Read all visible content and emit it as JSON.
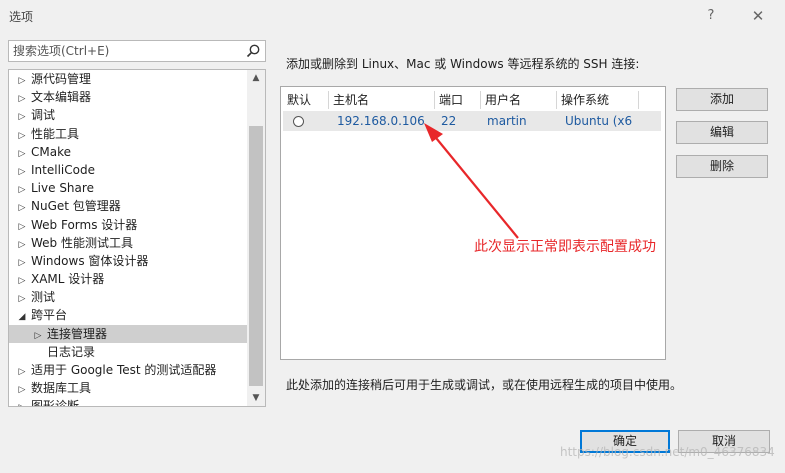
{
  "window": {
    "title": "选项",
    "help": "?",
    "close": "✕"
  },
  "search": {
    "placeholder": "搜索选项(Ctrl+E)"
  },
  "tree": [
    {
      "label": "源代码管理",
      "toggle": "▷"
    },
    {
      "label": "文本编辑器",
      "toggle": "▷"
    },
    {
      "label": "调试",
      "toggle": "▷"
    },
    {
      "label": "性能工具",
      "toggle": "▷"
    },
    {
      "label": "CMake",
      "toggle": "▷"
    },
    {
      "label": "IntelliCode",
      "toggle": "▷"
    },
    {
      "label": "Live Share",
      "toggle": "▷"
    },
    {
      "label": "NuGet 包管理器",
      "toggle": "▷"
    },
    {
      "label": "Web Forms 设计器",
      "toggle": "▷"
    },
    {
      "label": "Web 性能测试工具",
      "toggle": "▷"
    },
    {
      "label": "Windows 窗体设计器",
      "toggle": "▷"
    },
    {
      "label": "XAML 设计器",
      "toggle": "▷"
    },
    {
      "label": "测试",
      "toggle": "▷"
    },
    {
      "label": "跨平台",
      "toggle": "◢"
    },
    {
      "label": "连接管理器",
      "toggle": "▷"
    },
    {
      "label": "日志记录",
      "toggle": ""
    },
    {
      "label": "适用于 Google Test 的测试适配器",
      "toggle": "▷"
    },
    {
      "label": "数据库工具",
      "toggle": "▷"
    },
    {
      "label": "图形诊断",
      "toggle": "▷"
    }
  ],
  "intro": "添加或删除到 Linux、Mac 或 Windows 等远程系统的 SSH 连接:",
  "connections": {
    "headers": [
      "默认",
      "主机名",
      "端口",
      "用户名",
      "操作系统"
    ],
    "rows": [
      {
        "host": "192.168.0.106",
        "port": "22",
        "user": "martin",
        "os": "Ubuntu (x6"
      }
    ]
  },
  "buttons": {
    "add": "添加",
    "edit": "编辑",
    "delete": "删除",
    "ok": "确定",
    "cancel": "取消"
  },
  "note": "此处添加的连接稍后可用于生成或调试，或在使用远程生成的项目中使用。",
  "annotation": {
    "text": "此次显示正常即表示配置成功",
    "color": "#e8272a"
  },
  "watermark": "https://blog.csdn.net/m0_46376834"
}
